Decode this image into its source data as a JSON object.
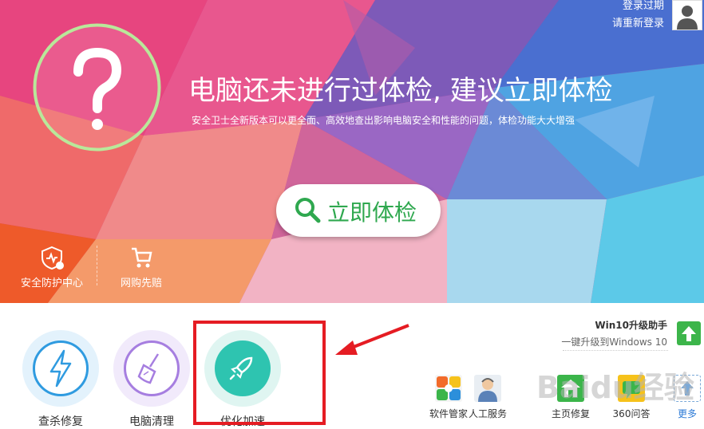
{
  "account": {
    "status": "登录过期",
    "relogin": "请重新登录"
  },
  "hero": {
    "headline": "电脑还未进行过体检, 建议立即体检",
    "subline": "安全卫士全新版本可以更全面、高效地查出影响电脑安全和性能的问题，体检功能大大增强",
    "check_button": "立即体检",
    "left_icons": [
      {
        "label": "安全防护中心",
        "icon": "shield-icon"
      },
      {
        "label": "网购先赔",
        "icon": "cart-icon"
      }
    ]
  },
  "tools": [
    {
      "label": "查杀修复",
      "icon": "lightning-icon",
      "color": "#2f9be0"
    },
    {
      "label": "电脑清理",
      "icon": "broom-icon",
      "color": "#a67ee0"
    },
    {
      "label": "优化加速",
      "icon": "rocket-icon",
      "color": "#2ec4b0"
    }
  ],
  "win10": {
    "title": "Win10升级助手",
    "desc": "一键升级到Windows 10"
  },
  "apps": [
    {
      "label": "软件管家",
      "icon": "software-manager-icon"
    },
    {
      "label": "人工服务",
      "icon": "customer-service-icon"
    },
    {
      "label": "主页修复",
      "icon": "homepage-repair-icon"
    },
    {
      "label": "360问答",
      "icon": "qa-icon"
    },
    {
      "label": "更多",
      "icon": "upload-more-icon"
    }
  ],
  "watermark": "Baidu经验",
  "colors": {
    "brand_green": "#2fa84f",
    "highlight_red": "#e51c23",
    "link_blue": "#2c7ad6"
  }
}
